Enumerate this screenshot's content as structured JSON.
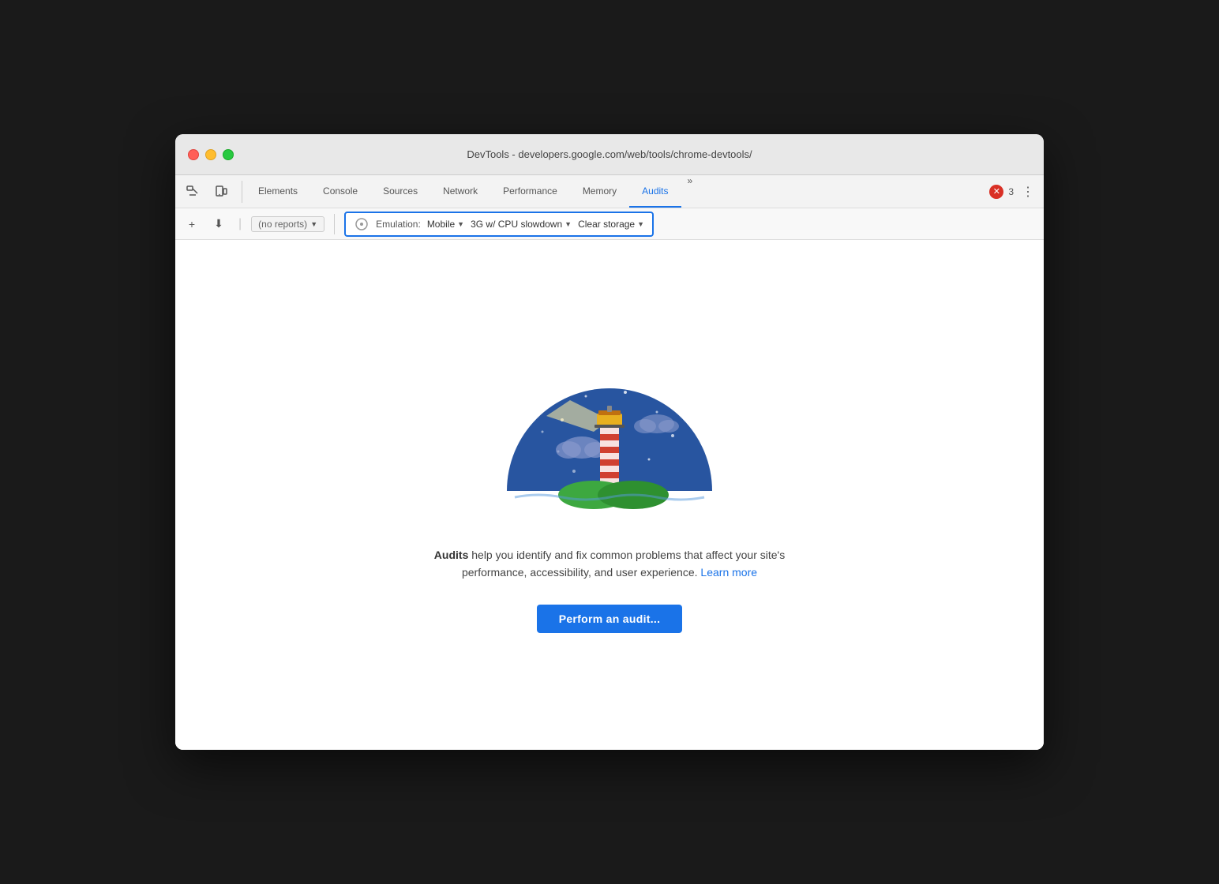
{
  "window": {
    "title": "DevTools - developers.google.com/web/tools/chrome-devtools/"
  },
  "traffic_lights": {
    "red": "red",
    "yellow": "yellow",
    "green": "green"
  },
  "nav": {
    "tabs": [
      {
        "label": "Elements",
        "active": false
      },
      {
        "label": "Console",
        "active": false
      },
      {
        "label": "Sources",
        "active": false
      },
      {
        "label": "Network",
        "active": false
      },
      {
        "label": "Performance",
        "active": false
      },
      {
        "label": "Memory",
        "active": false
      },
      {
        "label": "Audits",
        "active": true
      }
    ],
    "more_label": "»",
    "error_count": "3",
    "menu_icon": "⋮"
  },
  "toolbar": {
    "add_label": "+",
    "download_label": "⬇",
    "reports_placeholder": "(no reports)",
    "run_icon": "●",
    "emulation_label": "Emulation:",
    "emulation_value": "Mobile",
    "network_value": "3G w/ CPU slowdown",
    "clear_storage_label": "Clear storage"
  },
  "content": {
    "description_bold": "Audits",
    "description_text": " help you identify and fix common problems that affect your site's performance, accessibility, and user experience.",
    "learn_more_label": "Learn more",
    "perform_audit_label": "Perform an audit..."
  },
  "colors": {
    "accent_blue": "#1a73e8",
    "highlight_border": "#1a73e8",
    "error_red": "#d93025"
  }
}
